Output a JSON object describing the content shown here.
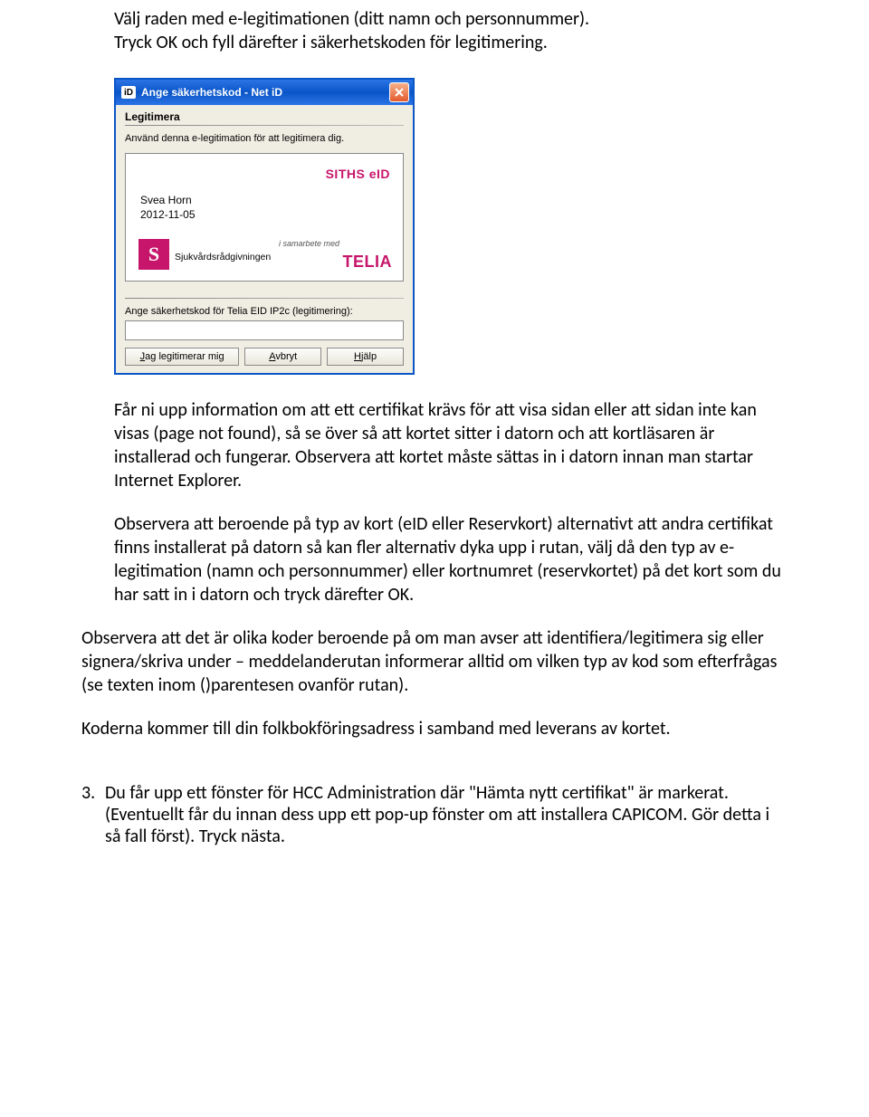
{
  "intro": {
    "line1": "Välj raden med e-legitimationen (ditt namn och personnummer).",
    "line2": "Tryck OK och fyll därefter i säkerhetskoden för legitimering."
  },
  "dialog": {
    "icon_text": "iD",
    "title": "Ange säkerhetskod - Net iD",
    "section_heading": "Legitimera",
    "hint": "Använd denna e-legitimation för att legitimera dig.",
    "card": {
      "watermark": "SITHS eID",
      "person_name": "Svea Horn",
      "person_date": "2012-11-05",
      "logo_letter": "S",
      "brand_text": "Sjukvårdsrådgivningen",
      "samarbete": "i samarbete med",
      "partner": "TELIA"
    },
    "field_label": "Ange säkerhetskod för Telia EID IP2c (legitimering):",
    "input_value": "",
    "buttons": {
      "submit": "Jag legitimerar mig",
      "submit_ul_char": "J",
      "cancel": "Avbryt",
      "cancel_ul_char": "A",
      "help": "Hjälp",
      "help_ul_char": "H"
    }
  },
  "paragraphs": {
    "p1": "Får ni upp information om att ett certifikat krävs för att visa sidan eller att sidan inte kan visas (page not found), så se över så att kortet sitter i datorn och att kortläsaren är installerad och fungerar. Observera att kortet måste sättas in i datorn innan man startar Internet Explorer.",
    "p2": "Observera att beroende på typ av kort (eID eller Reservkort) alternativt att andra certifikat finns installerat på datorn så kan fler alternativ dyka upp i rutan, välj då den typ av e-legitimation (namn och personnummer) eller kortnumret (reservkortet) på det kort som du har satt in i datorn och tryck därefter OK.",
    "p3": "Observera att det är olika koder beroende på om man avser att identifiera/legitimera sig eller signera/skriva under – meddelanderutan informerar alltid om vilken typ av kod som efterfrågas (se texten inom ()parentesen ovanför rutan).",
    "p4": "Koderna kommer till din folkbokföringsadress i samband med leverans av kortet."
  },
  "list3": {
    "num": "3.",
    "text": "Du får upp ett fönster för HCC Administration där \"Hämta nytt certifikat\" är markerat. (Eventuellt får du innan dess upp ett pop-up fönster om att installera CAPICOM. Gör detta i så fall först). Tryck nästa."
  }
}
